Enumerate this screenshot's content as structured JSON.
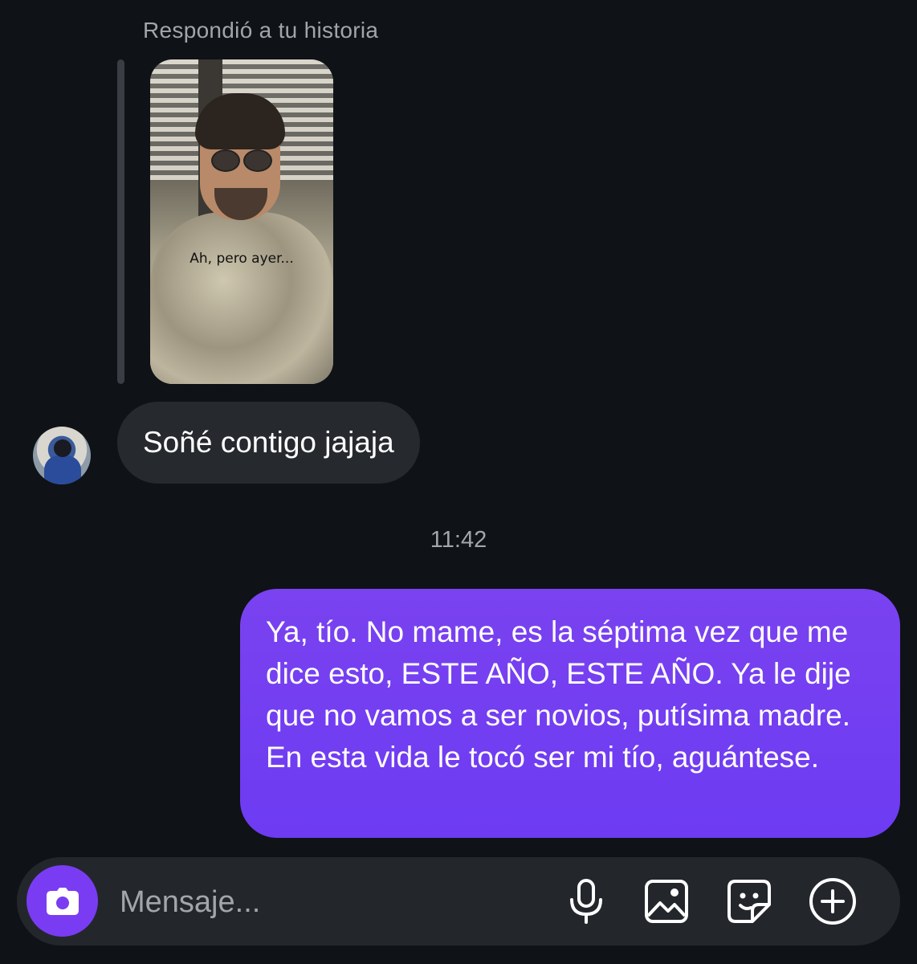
{
  "thread": {
    "story_reply_label": "Respondió a tu historia",
    "story_caption": "Ah, pero ayer...",
    "incoming_message": "Soñé contigo jajaja",
    "timestamp": "11:42",
    "outgoing_message": "Ya, tío. No mame, es la séptima vez que me dice esto, ESTE AÑO, ESTE AÑO. Ya le dije que no vamos a ser novios, putísima madre. En esta vida le tocó ser mi tío, aguántese."
  },
  "composer": {
    "placeholder": "Mensaje...",
    "icons": [
      "camera-icon",
      "microphone-icon",
      "gallery-icon",
      "sticker-icon",
      "plus-icon"
    ]
  },
  "colors": {
    "background": "#0f1216",
    "incoming_bubble": "#262a2f",
    "outgoing_bubble": "#7a42f0",
    "camera_button": "#7a3cf2",
    "secondary_text": "#a2a5aa"
  }
}
